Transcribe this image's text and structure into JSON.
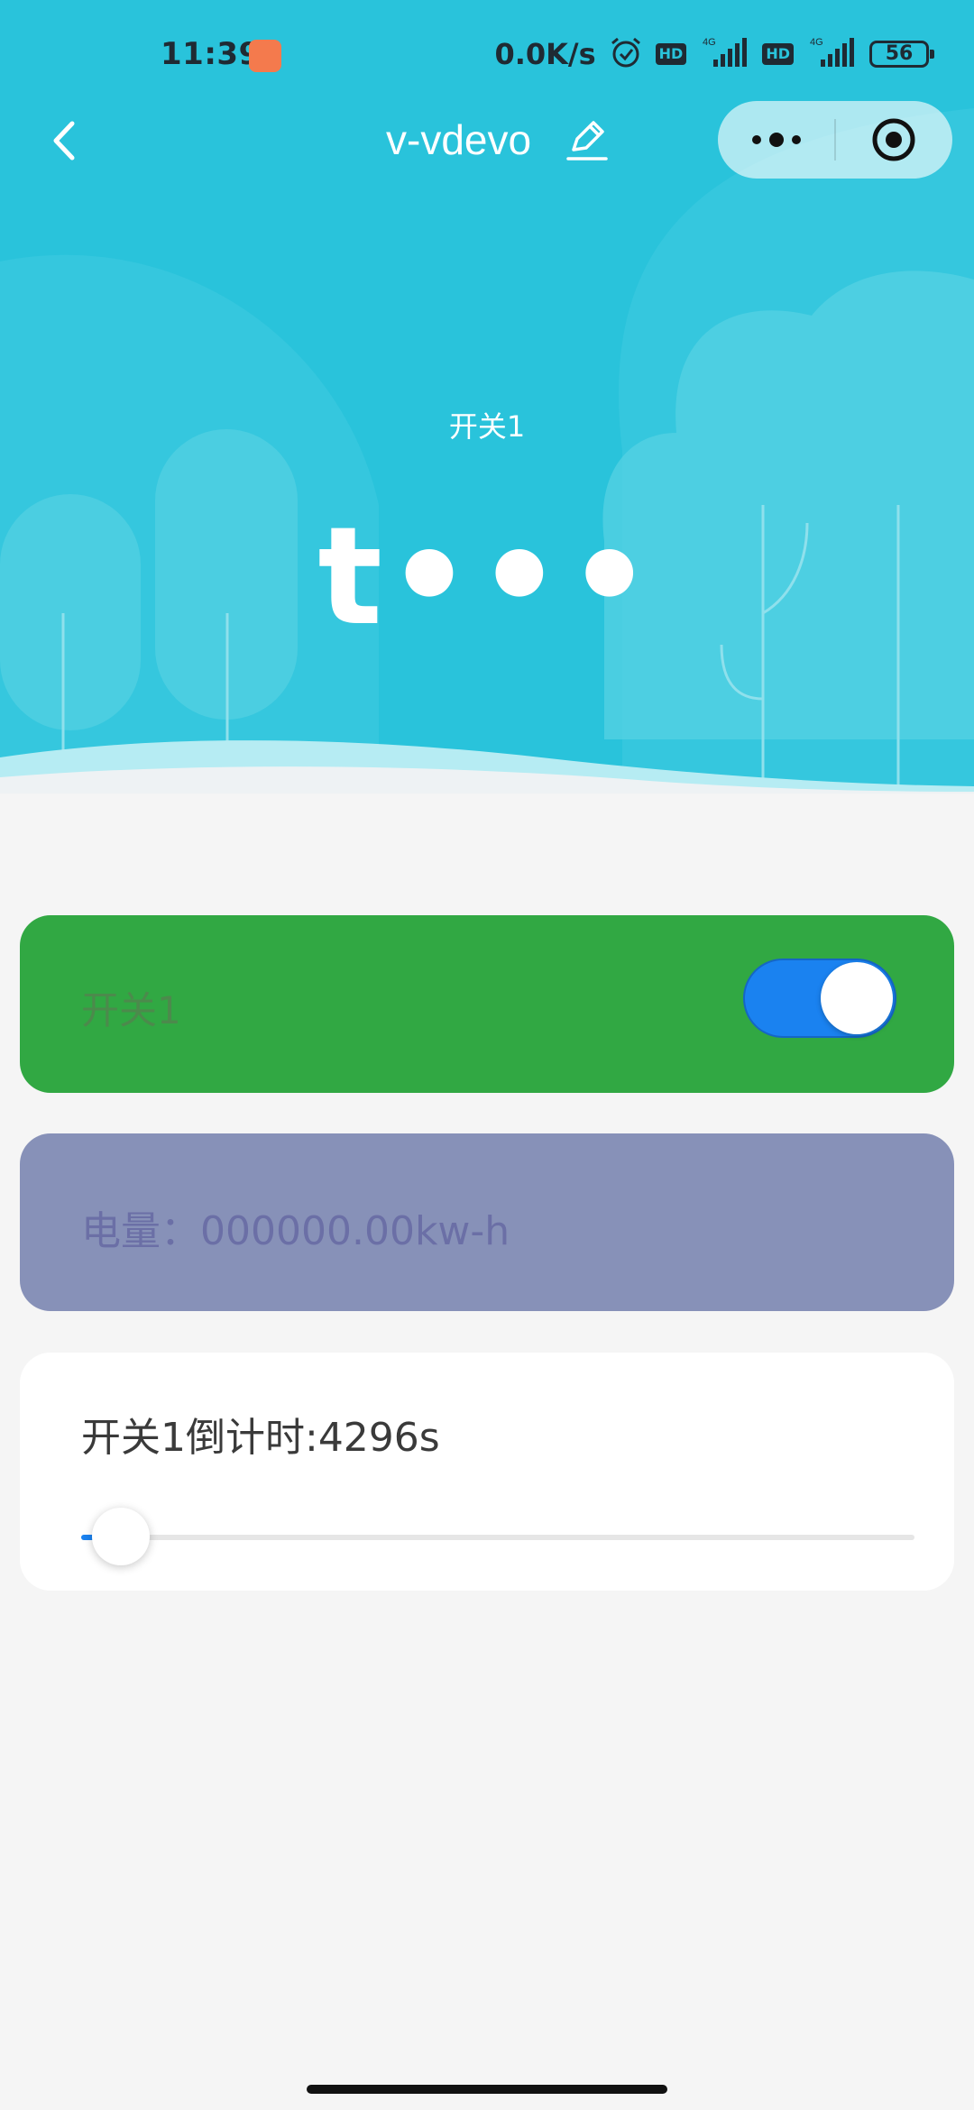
{
  "status_bar": {
    "time": "11:39",
    "network_speed": "0.0K/s",
    "hd_badge_1": "HD",
    "hd_badge_2": "HD",
    "signal_label_1": "4G",
    "signal_label_2": "4G",
    "battery_level": "56",
    "icons": [
      "app-notification-icon",
      "alarm-icon",
      "signal-icon",
      "battery-icon"
    ]
  },
  "navbar": {
    "title": "v-vdevo",
    "icons": [
      "back-arrow-icon",
      "edit-pencil-icon",
      "more-dots-icon",
      "close-target-icon"
    ]
  },
  "hero": {
    "label": "开关1",
    "value": "t•••"
  },
  "switch_card": {
    "label": "开关1",
    "on": true,
    "background": "#31a843",
    "toggle_color": "#1a82f0"
  },
  "energy_card": {
    "label": "电量：000000.00kw-h",
    "background": "#8791b8"
  },
  "timer_card": {
    "label": "开关1倒计时:4296s",
    "slider_value_fraction": 0.02
  },
  "colors": {
    "header": "#29c3db",
    "page_background": "#f5f5f5",
    "accent": "#1a82f0"
  }
}
